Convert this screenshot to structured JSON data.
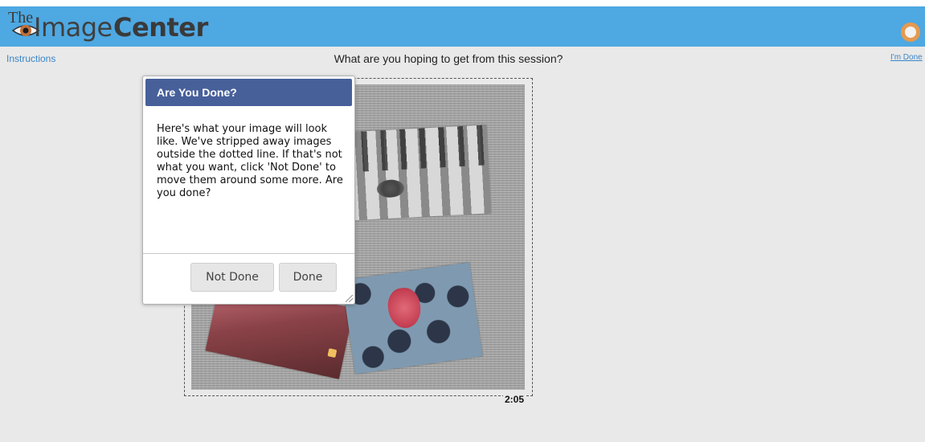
{
  "header": {
    "logo": {
      "the": "The",
      "image": "Image",
      "center": "Center"
    },
    "brand_color": "#4ea8e2",
    "right_icon": "ring-icon"
  },
  "topbar": {
    "instructions_label": "Instructions",
    "question": "What are you hoping to get from this session?",
    "done_label": "I'm Done"
  },
  "canvas": {
    "timer": "2:05",
    "photos": [
      "street-crosswalk-photo",
      "blueberries-raspberry-photo",
      "red-interior-photo"
    ]
  },
  "dialog": {
    "title": "Are You Done?",
    "body": "Here's what your image will look like. We've stripped away images outside the dotted line. If that's not what you want, click 'Not Done' to move them around some more. Are you done?",
    "not_done_label": "Not Done",
    "done_label": "Done",
    "title_color": "#47609a"
  }
}
